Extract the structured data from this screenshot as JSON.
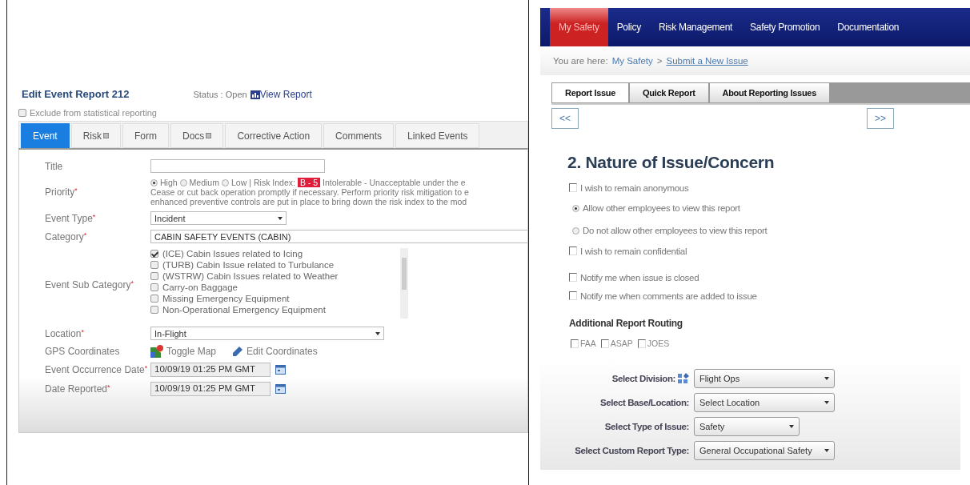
{
  "left": {
    "title": "Edit Event Report 212",
    "status": "Status : Open",
    "view_report": "View Report",
    "exclude": {
      "label": "Exclude from statistical reporting",
      "checked": false
    },
    "tabs": [
      {
        "label": "Event",
        "selected": true,
        "has_icon": false
      },
      {
        "label": "Risk",
        "selected": false,
        "has_icon": true
      },
      {
        "label": "Form",
        "selected": false,
        "has_icon": false
      },
      {
        "label": "Docs",
        "selected": false,
        "has_icon": true
      },
      {
        "label": "Corrective Action",
        "selected": false,
        "has_icon": false
      },
      {
        "label": "Comments",
        "selected": false,
        "has_icon": false
      },
      {
        "label": "Linked Events",
        "selected": false,
        "has_icon": false
      }
    ],
    "fields": [
      {
        "kind": "text",
        "label": "Title"
      },
      {
        "kind": "priority",
        "label": "Priority",
        "required_mark": "*",
        "options": [
          {
            "label": "High",
            "selected": true
          },
          {
            "label": "Medium",
            "selected": false
          },
          {
            "label": "Low",
            "selected": false
          }
        ],
        "separator": "|",
        "risk_label": "Risk Index:",
        "risk_badge": "B - 5",
        "description_lines": [
          "Intolerable - Unacceptable under the e",
          "Cease or cut back operation promptly if necessary. Perform priority risk mitigation to e",
          "enhanced preventive controls are put in place to bring down the risk index to the mod"
        ]
      },
      {
        "kind": "select",
        "label": "Event Type",
        "required_mark": "*",
        "value": "Incident"
      },
      {
        "kind": "wide",
        "label": "Category",
        "required_mark": "*",
        "value": "CABIN SAFETY EVENTS (CABIN)"
      },
      {
        "kind": "checklist",
        "label": "Event Sub Category",
        "required_mark": "*",
        "items": [
          {
            "label": "(ICE) Cabin Issues related to Icing",
            "checked": true
          },
          {
            "label": "(TURB) Cabin Issue related to Turbulance",
            "checked": false
          },
          {
            "label": "(WSTRW) Cabin Issues related to Weather",
            "checked": false
          },
          {
            "label": "Carry-on Baggage",
            "checked": false
          },
          {
            "label": "Missing Emergency Equipment",
            "checked": false
          },
          {
            "label": "Non-Operational Emergency Equipment",
            "checked": false
          }
        ]
      },
      {
        "kind": "select",
        "label": "Location",
        "required_mark": "*",
        "value": "In-Flight"
      },
      {
        "kind": "links",
        "label": "GPS Coordinates",
        "links": [
          "Toggle Map",
          "Edit Coordinates"
        ]
      },
      {
        "kind": "date",
        "label": "Event Occurrence Date",
        "required_mark": "*",
        "value": "10/09/19 01:25 PM GMT"
      },
      {
        "kind": "date",
        "label": "Date Reported",
        "required_mark": "*",
        "value": "10/09/19 01:25 PM GMT"
      }
    ]
  },
  "right": {
    "nav": [
      {
        "label": "My Safety",
        "selected": true
      },
      {
        "label": "Policy",
        "selected": false
      },
      {
        "label": "Risk Management",
        "selected": false
      },
      {
        "label": "Safety Promotion",
        "selected": false
      },
      {
        "label": "Documentation",
        "selected": false
      }
    ],
    "breadcrumb": {
      "label": "You are here:",
      "trail": "My Safety",
      "separator": ">",
      "current": "Submit a New Issue"
    },
    "tabs": [
      {
        "label": "Report Issue",
        "selected": true
      },
      {
        "label": "Quick Report",
        "selected": false
      },
      {
        "label": "About Reporting Issues",
        "selected": false
      }
    ],
    "prev": "<<",
    "next": ">>",
    "heading": "2. Nature of Issue/Concern",
    "options": [
      {
        "kind": "checkbox",
        "label": "I wish to remain anonymous",
        "checked": false
      },
      {
        "kind": "radio",
        "label": "Allow other employees to view this report",
        "selected": true
      },
      {
        "kind": "radio",
        "label": "Do not allow other employees to view this report",
        "selected": false
      },
      {
        "kind": "checkbox",
        "label": "I wish to remain confidential",
        "checked": false
      },
      {
        "kind": "checkbox",
        "label": "Notify me when issue is closed",
        "checked": false
      },
      {
        "kind": "checkbox",
        "label": "Notify me when comments are added to issue",
        "checked": false
      }
    ],
    "routing_title": "Additional Report Routing",
    "routing": [
      {
        "label": "FAA",
        "checked": false
      },
      {
        "label": "ASAP",
        "checked": false
      },
      {
        "label": "JOES",
        "checked": false
      }
    ],
    "selects": [
      {
        "label": "Select Division:",
        "value": "Flight Ops",
        "has_icon": true
      },
      {
        "label": "Select Base/Location:",
        "value": "Select Location",
        "has_icon": false
      },
      {
        "label": "Select Type of Issue:",
        "value": "Safety",
        "has_icon": false
      },
      {
        "label": "Select Custom Report Type:",
        "value": "General Occupational Safety",
        "has_icon": false
      }
    ]
  }
}
